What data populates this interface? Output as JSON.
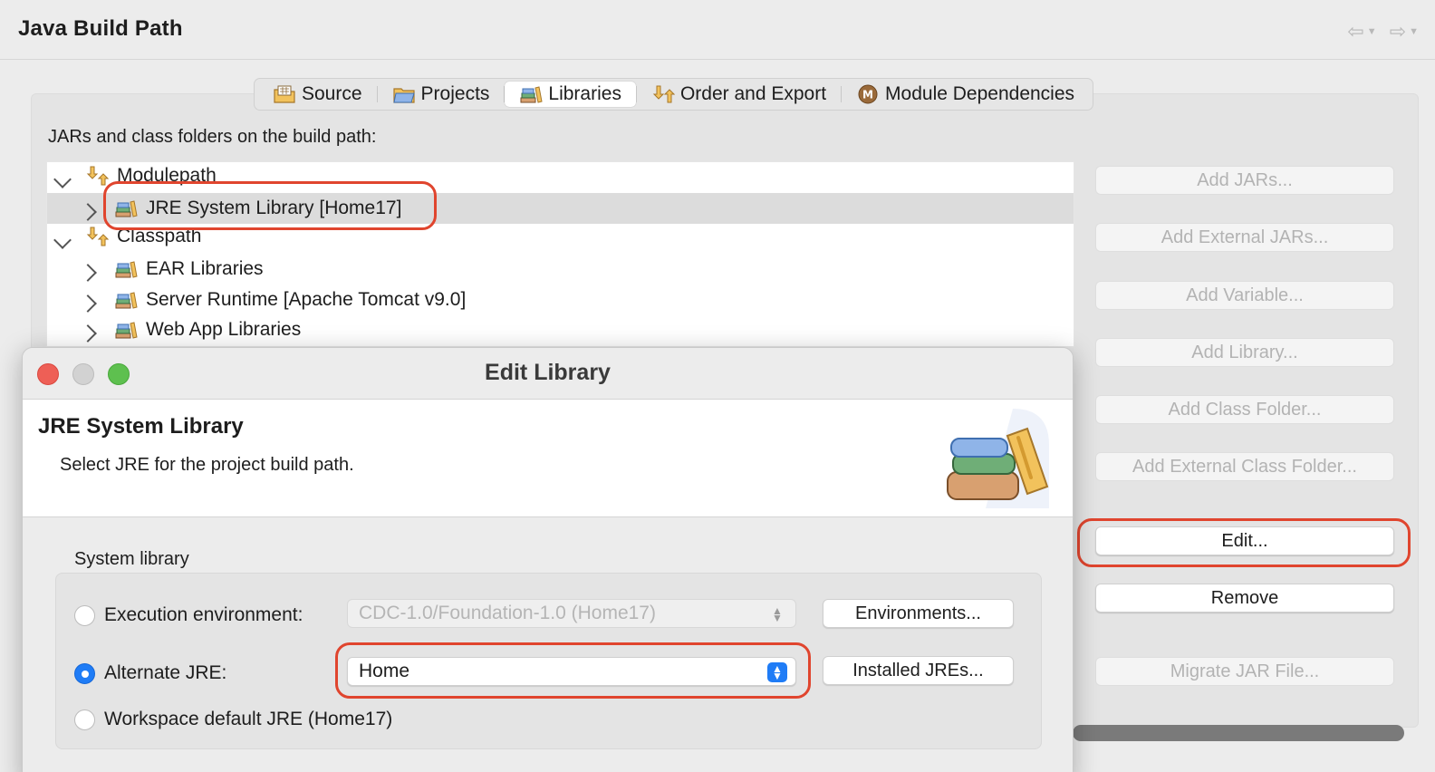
{
  "header": {
    "title": "Java Build Path"
  },
  "tabs": [
    {
      "label": "Source",
      "icon": "source-folder-icon",
      "active": false
    },
    {
      "label": "Projects",
      "icon": "projects-folder-icon",
      "active": false
    },
    {
      "label": "Libraries",
      "icon": "libraries-icon",
      "active": true
    },
    {
      "label": "Order and Export",
      "icon": "order-export-icon",
      "active": false
    },
    {
      "label": "Module Dependencies",
      "icon": "module-icon",
      "active": false
    }
  ],
  "libraries": {
    "list_label": "JARs and class folders on the build path:",
    "tree": [
      {
        "label": "Modulepath",
        "level": 0,
        "expanded": true
      },
      {
        "label": "JRE System Library [Home17]",
        "level": 1,
        "selected": true
      },
      {
        "label": "Classpath",
        "level": 0,
        "expanded": true
      },
      {
        "label": "EAR Libraries",
        "level": 1
      },
      {
        "label": "Server Runtime [Apache Tomcat v9.0]",
        "level": 1
      },
      {
        "label": "Web App Libraries",
        "level": 1
      }
    ],
    "buttons": {
      "add_jars": "Add JARs...",
      "add_external_jars": "Add External JARs...",
      "add_variable": "Add Variable...",
      "add_library": "Add Library...",
      "add_class_folder": "Add Class Folder...",
      "add_external_class_folder": "Add External Class Folder...",
      "edit": "Edit...",
      "remove": "Remove",
      "migrate_jar": "Migrate JAR File..."
    }
  },
  "dialog": {
    "title": "Edit Library",
    "banner_title": "JRE System Library",
    "banner_desc": "Select JRE for the project build path.",
    "group_label": "System library",
    "execution_env": {
      "label": "Execution environment:",
      "value": "CDC-1.0/Foundation-1.0 (Home17)",
      "button": "Environments..."
    },
    "alternate_jre": {
      "label": "Alternate JRE:",
      "value": "Home",
      "button": "Installed JREs..."
    },
    "workspace_default": {
      "label": "Workspace default JRE (Home17)"
    }
  },
  "colors": {
    "accent": "#1f7cf6",
    "highlight": "#e0452e"
  }
}
